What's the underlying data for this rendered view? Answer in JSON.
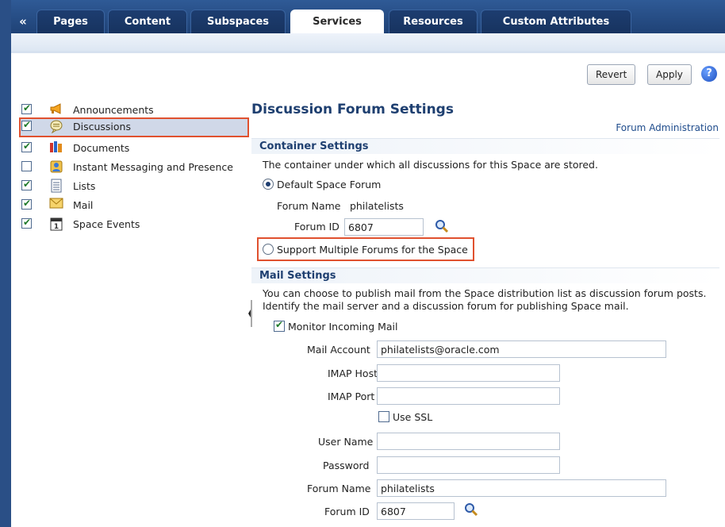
{
  "nav": {
    "collapse_glyph": "«",
    "tabs": [
      {
        "label": "Pages"
      },
      {
        "label": "Content"
      },
      {
        "label": "Subspaces"
      },
      {
        "label": "Services"
      },
      {
        "label": "Resources"
      },
      {
        "label": "Custom Attributes"
      }
    ],
    "active_tab": "Services"
  },
  "toolbar": {
    "revert_label": "Revert",
    "apply_label": "Apply",
    "help_glyph": "?"
  },
  "services": [
    {
      "label": "Announcements",
      "checked": true,
      "icon": "megaphone-icon"
    },
    {
      "label": "Discussions",
      "checked": true,
      "icon": "speech-bubble-icon",
      "selected": true
    },
    {
      "label": "Documents",
      "checked": true,
      "icon": "books-icon"
    },
    {
      "label": "Instant Messaging and Presence",
      "checked": false,
      "icon": "presence-icon"
    },
    {
      "label": "Lists",
      "checked": true,
      "icon": "list-icon"
    },
    {
      "label": "Mail",
      "checked": true,
      "icon": "envelope-icon"
    },
    {
      "label": "Space Events",
      "checked": true,
      "icon": "calendar-icon"
    }
  ],
  "panel": {
    "title": "Discussion Forum Settings",
    "forum_admin_link": "Forum Administration",
    "container": {
      "heading": "Container Settings",
      "description": "The container under which all discussions for this Space are stored.",
      "default_option": "Default Space Forum",
      "forum_name_label": "Forum Name",
      "forum_name_value": "philatelists",
      "forum_id_label": "Forum ID",
      "forum_id_value": "6807",
      "multiple_option": "Support Multiple Forums for the Space"
    },
    "mail": {
      "heading": "Mail Settings",
      "description_line1": "You can choose to publish mail from the Space distribution list as discussion forum posts.",
      "description_line2": "Identify the mail server and a discussion forum for publishing Space mail.",
      "monitor_label": "Monitor Incoming Mail",
      "mail_account_label": "Mail Account",
      "mail_account_value": "philatelists@oracle.com",
      "imap_host_label": "IMAP Host",
      "imap_host_value": "",
      "imap_port_label": "IMAP Port",
      "imap_port_value": "",
      "use_ssl_label": "Use SSL",
      "user_name_label": "User Name",
      "user_name_value": "",
      "password_label": "Password",
      "password_value": "",
      "forum_name_label": "Forum Name",
      "forum_name_value": "philatelists",
      "forum_id_label": "Forum ID",
      "forum_id_value": "6807"
    }
  },
  "colors": {
    "frame": "#2a4f86",
    "highlight": "#e0512f",
    "heading": "#1e3f70"
  }
}
